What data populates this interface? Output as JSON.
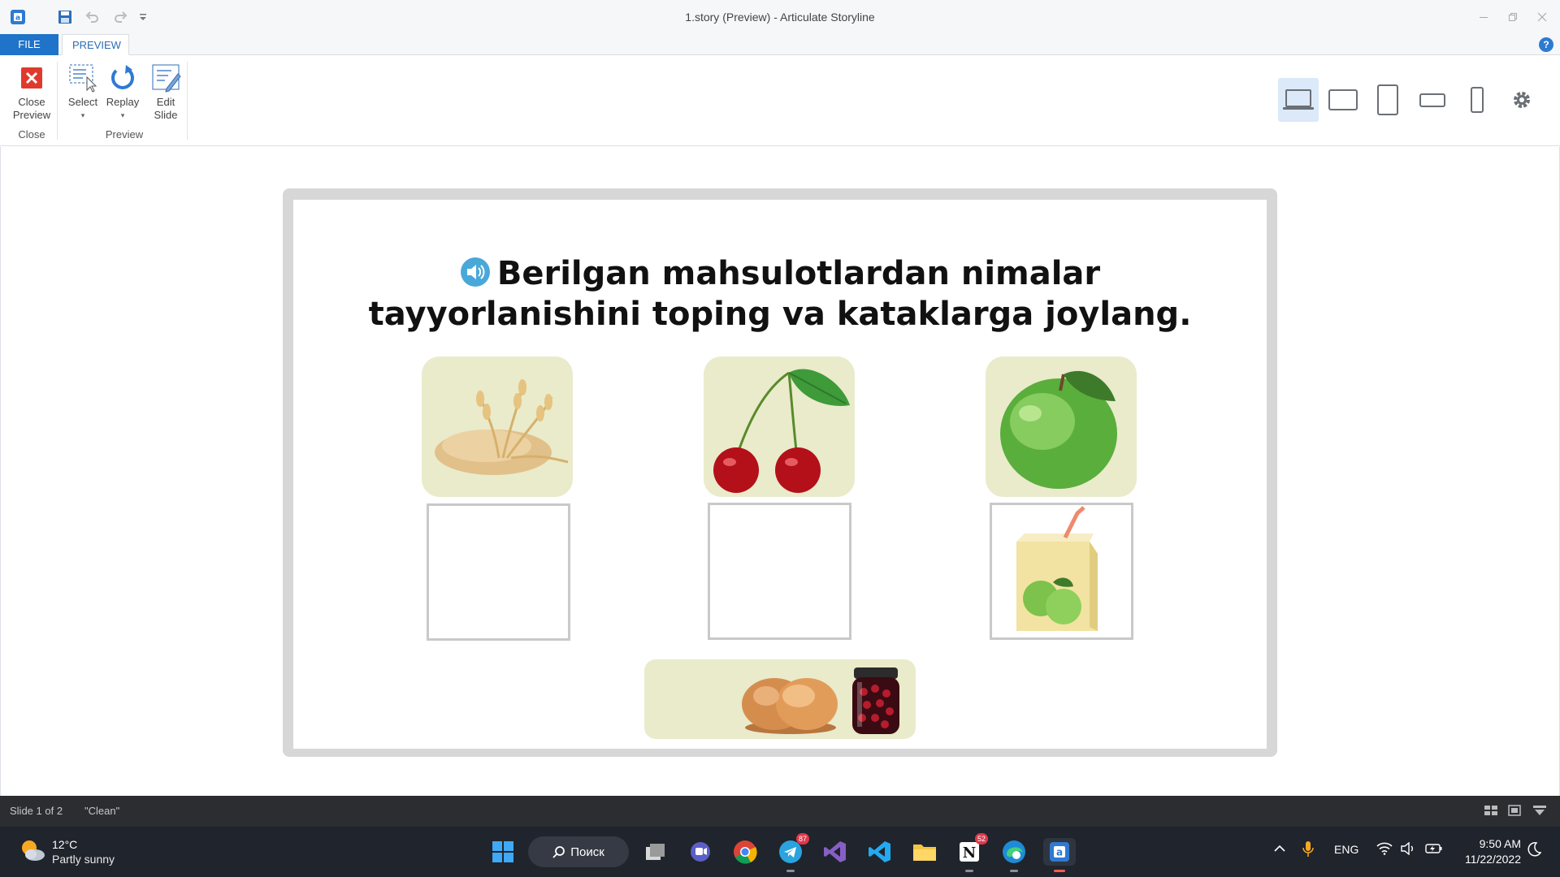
{
  "window": {
    "title": "1.story (Preview) -  Articulate Storyline"
  },
  "ribbon": {
    "tabs": {
      "file": "FILE",
      "preview": "PREVIEW"
    },
    "help": "?",
    "close_preview": {
      "line1": "Close",
      "line2": "Preview"
    },
    "select": "Select",
    "replay": "Replay",
    "edit_slide": {
      "line1": "Edit",
      "line2": "Slide"
    },
    "groups": {
      "close": "Close",
      "preview": "Preview"
    },
    "devices": [
      "desktop",
      "tablet-landscape",
      "tablet-portrait",
      "phone-landscape",
      "phone-portrait"
    ],
    "active_device": "desktop"
  },
  "slide": {
    "heading_line1": "Berilgan mahsulotlardan nimalar",
    "heading_line2": "tayyorlanishini toping va kataklarga joylang.",
    "products": [
      "wheat",
      "cherries",
      "apple"
    ],
    "answers": [
      "",
      "",
      "juice-box"
    ],
    "tray_items": [
      "bread",
      "jam-jar"
    ],
    "colors": {
      "card_bg": "#e9ebcb",
      "frame": "#d7d7d7",
      "accent": "#1f73c8"
    }
  },
  "status": {
    "slide_count": "Slide 1 of 2",
    "theme": "\"Clean\""
  },
  "taskbar": {
    "weather_temp": "12°C",
    "weather_cond": "Partly sunny",
    "search_label": "Поиск",
    "telegram_badge": "87",
    "notion_badge": "52",
    "language": "ENG",
    "time": "9:50 AM",
    "date": "11/22/2022"
  }
}
